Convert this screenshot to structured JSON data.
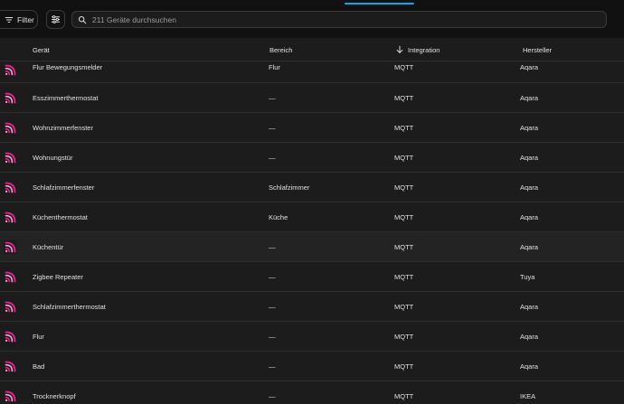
{
  "toolbar": {
    "filter_label": "Filter",
    "search_placeholder": "211 Geräte durchsuchen"
  },
  "columns": {
    "device": "Gerät",
    "area": "Bereich",
    "integration": "Integration",
    "manufacturer": "Hersteller"
  },
  "colors": {
    "accent": "#03a9f4",
    "icon_pink": "#e91e8c"
  },
  "rows": [
    {
      "name": "Flur Bewegungsmelder",
      "area": "Flur",
      "integration": "MQTT",
      "manufacturer": "Aqara"
    },
    {
      "name": "Esszimmerthermostat",
      "area": "—",
      "integration": "MQTT",
      "manufacturer": "Aqara"
    },
    {
      "name": "Wohnzimmerfenster",
      "area": "—",
      "integration": "MQTT",
      "manufacturer": "Aqara"
    },
    {
      "name": "Wohnungstür",
      "area": "—",
      "integration": "MQTT",
      "manufacturer": "Aqara"
    },
    {
      "name": "Schlafzimmerfenster",
      "area": "Schlafzimmer",
      "integration": "MQTT",
      "manufacturer": "Aqara"
    },
    {
      "name": "Küchenthermostat",
      "area": "Küche",
      "integration": "MQTT",
      "manufacturer": "Aqara"
    },
    {
      "name": "Küchentür",
      "area": "—",
      "integration": "MQTT",
      "manufacturer": "Aqara"
    },
    {
      "name": "Zigbee Repeater",
      "area": "—",
      "integration": "MQTT",
      "manufacturer": "Tuya"
    },
    {
      "name": "Schlafzimmerthermostat",
      "area": "—",
      "integration": "MQTT",
      "manufacturer": "Aqara"
    },
    {
      "name": "Flur",
      "area": "—",
      "integration": "MQTT",
      "manufacturer": "Aqara"
    },
    {
      "name": "Bad",
      "area": "—",
      "integration": "MQTT",
      "manufacturer": "Aqara"
    },
    {
      "name": "Trocknerknopf",
      "area": "—",
      "integration": "MQTT",
      "manufacturer": "IKEA"
    }
  ]
}
